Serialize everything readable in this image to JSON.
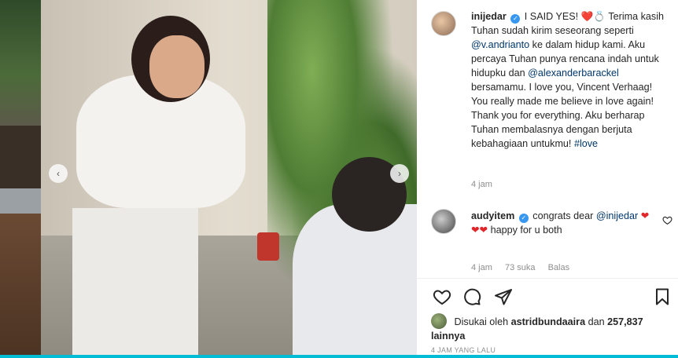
{
  "post": {
    "prev_arrow": "‹",
    "next_arrow": "›"
  },
  "caption": {
    "username": "inijedar",
    "headline": "I SAID YES!",
    "headline_emoji": "❤️💍",
    "text_1": "Terima kasih Tuhan sudah kirim seseorang seperti",
    "mention_1": "@v.andrianto",
    "text_2": "ke dalam hidup kami. Aku percaya Tuhan punya rencana indah untuk hidupku dan",
    "mention_2": "@alexanderbarackel",
    "text_3": "bersamamu. I love you, Vincent Verhaag! You really made me believe in love again! Thank you for everything. Aku berharap Tuhan membalasnya dengan berjuta kebahagiaan untukmu!",
    "hashtag": "#love",
    "time": "4 jam"
  },
  "comment": {
    "username": "audyitem",
    "text_1": "congrats dear",
    "mention": "@inijedar",
    "hearts": "❤❤❤",
    "text_2": "happy for u both",
    "time": "4 jam",
    "likes": "73 suka",
    "reply": "Balas"
  },
  "likes": {
    "prefix": "Disukai oleh",
    "user": "astridbundaaira",
    "connector": "dan",
    "count": "257,837 lainnya"
  },
  "posted": "4 JAM YANG LALU",
  "colors": {
    "link": "#00376b",
    "verified": "#3897f0",
    "heart": "#e0262a",
    "bottom_bar": "#00bcd4"
  }
}
